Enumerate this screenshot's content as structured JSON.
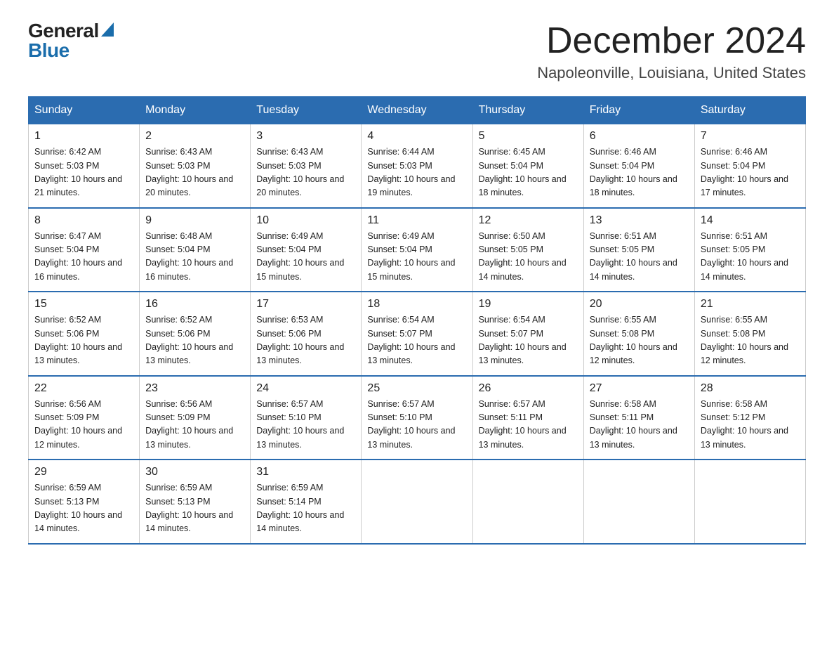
{
  "logo": {
    "general": "General",
    "blue": "Blue"
  },
  "header": {
    "month": "December 2024",
    "location": "Napoleonville, Louisiana, United States"
  },
  "weekdays": [
    "Sunday",
    "Monday",
    "Tuesday",
    "Wednesday",
    "Thursday",
    "Friday",
    "Saturday"
  ],
  "weeks": [
    [
      {
        "day": 1,
        "sunrise": "6:42 AM",
        "sunset": "5:03 PM",
        "daylight": "10 hours and 21 minutes."
      },
      {
        "day": 2,
        "sunrise": "6:43 AM",
        "sunset": "5:03 PM",
        "daylight": "10 hours and 20 minutes."
      },
      {
        "day": 3,
        "sunrise": "6:43 AM",
        "sunset": "5:03 PM",
        "daylight": "10 hours and 20 minutes."
      },
      {
        "day": 4,
        "sunrise": "6:44 AM",
        "sunset": "5:03 PM",
        "daylight": "10 hours and 19 minutes."
      },
      {
        "day": 5,
        "sunrise": "6:45 AM",
        "sunset": "5:04 PM",
        "daylight": "10 hours and 18 minutes."
      },
      {
        "day": 6,
        "sunrise": "6:46 AM",
        "sunset": "5:04 PM",
        "daylight": "10 hours and 18 minutes."
      },
      {
        "day": 7,
        "sunrise": "6:46 AM",
        "sunset": "5:04 PM",
        "daylight": "10 hours and 17 minutes."
      }
    ],
    [
      {
        "day": 8,
        "sunrise": "6:47 AM",
        "sunset": "5:04 PM",
        "daylight": "10 hours and 16 minutes."
      },
      {
        "day": 9,
        "sunrise": "6:48 AM",
        "sunset": "5:04 PM",
        "daylight": "10 hours and 16 minutes."
      },
      {
        "day": 10,
        "sunrise": "6:49 AM",
        "sunset": "5:04 PM",
        "daylight": "10 hours and 15 minutes."
      },
      {
        "day": 11,
        "sunrise": "6:49 AM",
        "sunset": "5:04 PM",
        "daylight": "10 hours and 15 minutes."
      },
      {
        "day": 12,
        "sunrise": "6:50 AM",
        "sunset": "5:05 PM",
        "daylight": "10 hours and 14 minutes."
      },
      {
        "day": 13,
        "sunrise": "6:51 AM",
        "sunset": "5:05 PM",
        "daylight": "10 hours and 14 minutes."
      },
      {
        "day": 14,
        "sunrise": "6:51 AM",
        "sunset": "5:05 PM",
        "daylight": "10 hours and 14 minutes."
      }
    ],
    [
      {
        "day": 15,
        "sunrise": "6:52 AM",
        "sunset": "5:06 PM",
        "daylight": "10 hours and 13 minutes."
      },
      {
        "day": 16,
        "sunrise": "6:52 AM",
        "sunset": "5:06 PM",
        "daylight": "10 hours and 13 minutes."
      },
      {
        "day": 17,
        "sunrise": "6:53 AM",
        "sunset": "5:06 PM",
        "daylight": "10 hours and 13 minutes."
      },
      {
        "day": 18,
        "sunrise": "6:54 AM",
        "sunset": "5:07 PM",
        "daylight": "10 hours and 13 minutes."
      },
      {
        "day": 19,
        "sunrise": "6:54 AM",
        "sunset": "5:07 PM",
        "daylight": "10 hours and 13 minutes."
      },
      {
        "day": 20,
        "sunrise": "6:55 AM",
        "sunset": "5:08 PM",
        "daylight": "10 hours and 12 minutes."
      },
      {
        "day": 21,
        "sunrise": "6:55 AM",
        "sunset": "5:08 PM",
        "daylight": "10 hours and 12 minutes."
      }
    ],
    [
      {
        "day": 22,
        "sunrise": "6:56 AM",
        "sunset": "5:09 PM",
        "daylight": "10 hours and 12 minutes."
      },
      {
        "day": 23,
        "sunrise": "6:56 AM",
        "sunset": "5:09 PM",
        "daylight": "10 hours and 13 minutes."
      },
      {
        "day": 24,
        "sunrise": "6:57 AM",
        "sunset": "5:10 PM",
        "daylight": "10 hours and 13 minutes."
      },
      {
        "day": 25,
        "sunrise": "6:57 AM",
        "sunset": "5:10 PM",
        "daylight": "10 hours and 13 minutes."
      },
      {
        "day": 26,
        "sunrise": "6:57 AM",
        "sunset": "5:11 PM",
        "daylight": "10 hours and 13 minutes."
      },
      {
        "day": 27,
        "sunrise": "6:58 AM",
        "sunset": "5:11 PM",
        "daylight": "10 hours and 13 minutes."
      },
      {
        "day": 28,
        "sunrise": "6:58 AM",
        "sunset": "5:12 PM",
        "daylight": "10 hours and 13 minutes."
      }
    ],
    [
      {
        "day": 29,
        "sunrise": "6:59 AM",
        "sunset": "5:13 PM",
        "daylight": "10 hours and 14 minutes."
      },
      {
        "day": 30,
        "sunrise": "6:59 AM",
        "sunset": "5:13 PM",
        "daylight": "10 hours and 14 minutes."
      },
      {
        "day": 31,
        "sunrise": "6:59 AM",
        "sunset": "5:14 PM",
        "daylight": "10 hours and 14 minutes."
      },
      null,
      null,
      null,
      null
    ]
  ]
}
